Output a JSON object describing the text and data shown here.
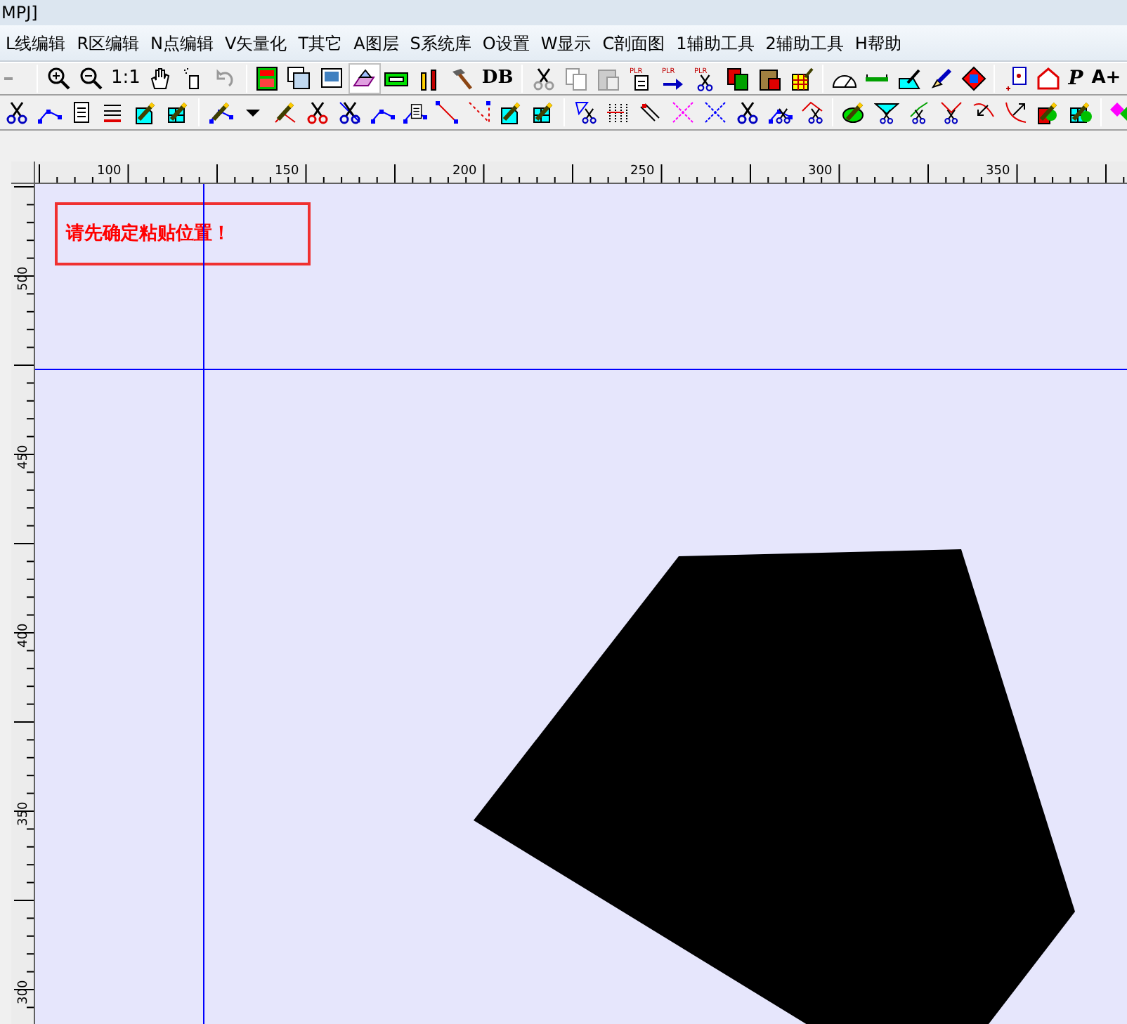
{
  "window": {
    "title": "MPJ]"
  },
  "menu": [
    "L线编辑",
    "R区编辑",
    "N点编辑",
    "V矢量化",
    "T其它",
    "A图层",
    "S系统库",
    "O设置",
    "W显示",
    "C剖面图",
    "1辅助工具",
    "2辅助工具",
    "H帮助"
  ],
  "toolbar_texts": [
    "1:1",
    "DB",
    "P",
    "A+"
  ],
  "icon_labels": [
    "PLR",
    "PLR",
    "PLR"
  ],
  "horizontal_ruler": [
    "100",
    "150",
    "200",
    "250",
    "300",
    "350"
  ],
  "vertical_ruler": [
    "500",
    "450",
    "400",
    "350",
    "300"
  ],
  "canvas": {
    "message": "请先确定粘贴位置！"
  }
}
